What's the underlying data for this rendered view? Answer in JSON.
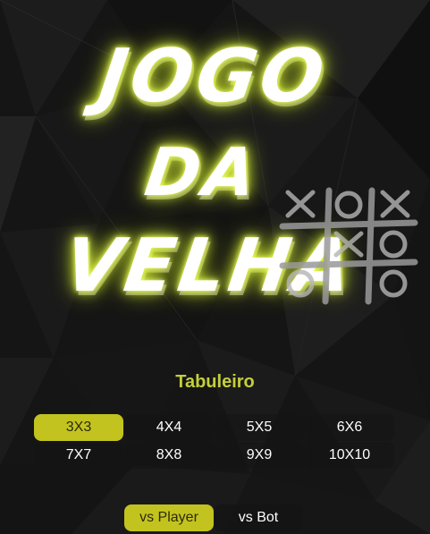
{
  "title": {
    "line1": "JOGO",
    "line2": "DA",
    "line3": "VELHA"
  },
  "board_label": "Tabuleiro",
  "board_sizes": [
    "3X3",
    "4X4",
    "5X5",
    "6X6",
    "7X7",
    "8X8",
    "9X9",
    "10X10"
  ],
  "selected_board_size": "3X3",
  "modes": [
    "vs Player",
    "vs Bot"
  ],
  "selected_mode": "vs Player",
  "colors": {
    "accent": "#c3c31f",
    "label": "#c4cf3a",
    "glow": "#e2f53a",
    "background": "#141414"
  },
  "icons": [
    "tic-tac-toe-grid-icon"
  ]
}
